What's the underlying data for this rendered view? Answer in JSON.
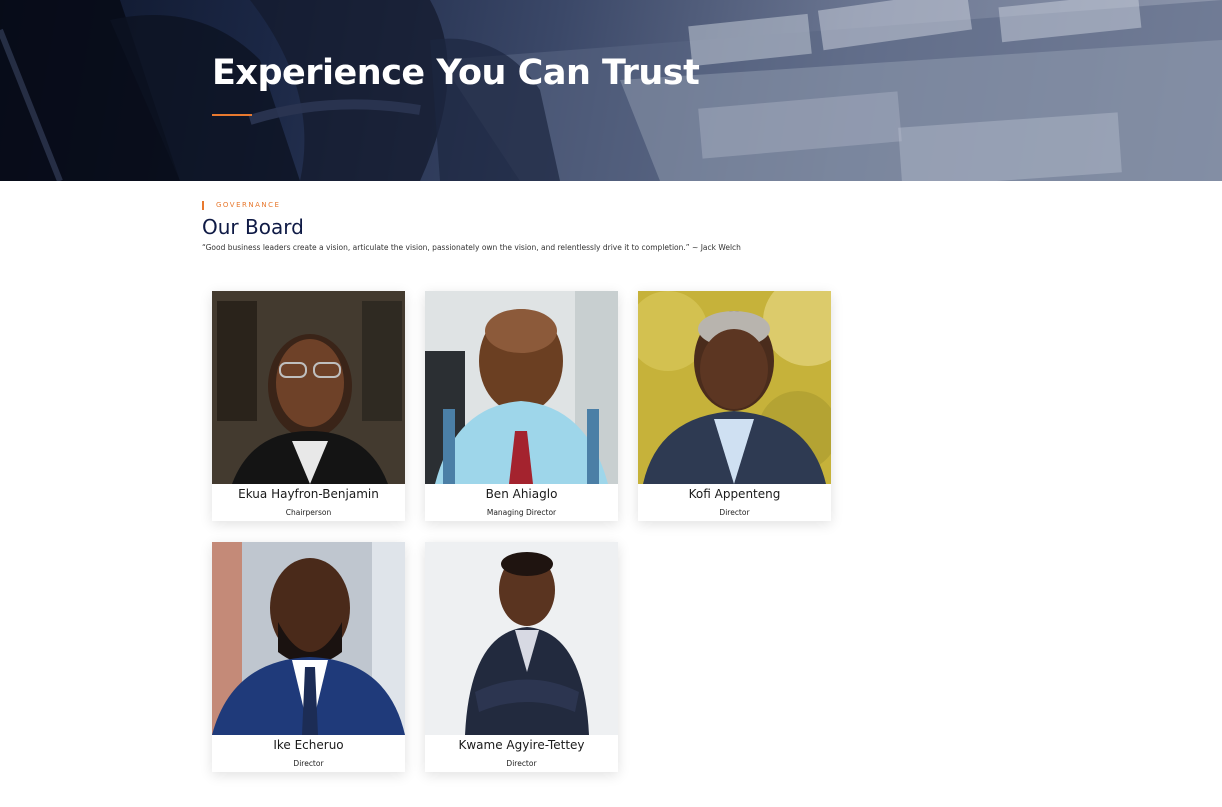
{
  "hero": {
    "title": "Experience You Can Trust",
    "accent_color": "#e8792f"
  },
  "section": {
    "tag": "GOVERNANCE",
    "title": "Our Board",
    "quote": "“Good business leaders create a vision, articulate the vision, passionately own the vision, and relentlessly drive it to completion.” ~ Jack Welch"
  },
  "board": [
    {
      "name": "Ekua Hayfron-Benjamin",
      "role": "Chairperson"
    },
    {
      "name": "Ben Ahiaglo",
      "role": "Managing Director"
    },
    {
      "name": "Kofi Appenteng",
      "role": "Director"
    },
    {
      "name": "Ike Echeruo",
      "role": "Director"
    },
    {
      "name": "Kwame Agyire-Tettey",
      "role": "Director"
    }
  ],
  "colors": {
    "title_navy": "#0f1a45",
    "accent_orange": "#e8792f",
    "hero_dark": "#0c1427"
  }
}
